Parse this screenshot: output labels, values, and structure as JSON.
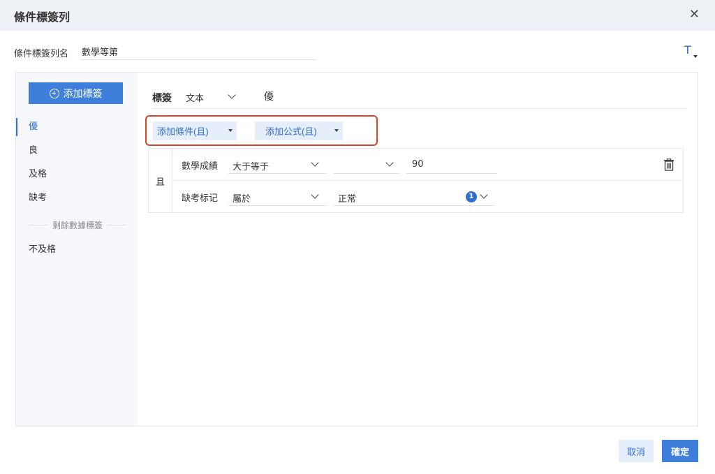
{
  "dialog": {
    "title": "條件標簽列",
    "close_label": "✕"
  },
  "name_field": {
    "label": "條件標簽列名",
    "value": "數學等第"
  },
  "toolbar": {
    "text_style_icon": "T"
  },
  "sidebar": {
    "add_button_label": "添加標簽",
    "tags": [
      {
        "label": "優",
        "active": true
      },
      {
        "label": "良",
        "active": false
      },
      {
        "label": "及格",
        "active": false
      },
      {
        "label": "缺考",
        "active": false
      }
    ],
    "remaining_label": "剩餘數據標簽",
    "remaining_tags": [
      {
        "label": "不及格"
      }
    ]
  },
  "editor": {
    "tag_label": "標簽",
    "type_value": "文本",
    "tag_value": "優",
    "add_condition_label": "添加條件(且)",
    "add_formula_label": "添加公式(且)",
    "logic_label": "且",
    "conditions": [
      {
        "field": "數學成績",
        "operator": "大于等于",
        "mode": "",
        "value": "90"
      },
      {
        "field": "缺考标记",
        "operator": "屬於",
        "value": "正常",
        "badge": "1"
      }
    ]
  },
  "footer": {
    "cancel_label": "取消",
    "ok_label": "確定"
  },
  "colors": {
    "primary": "#3f7fdc",
    "light_primary": "#e6eefb",
    "highlight": "#d9442b",
    "sidebar_bg": "#f6f8fb"
  }
}
